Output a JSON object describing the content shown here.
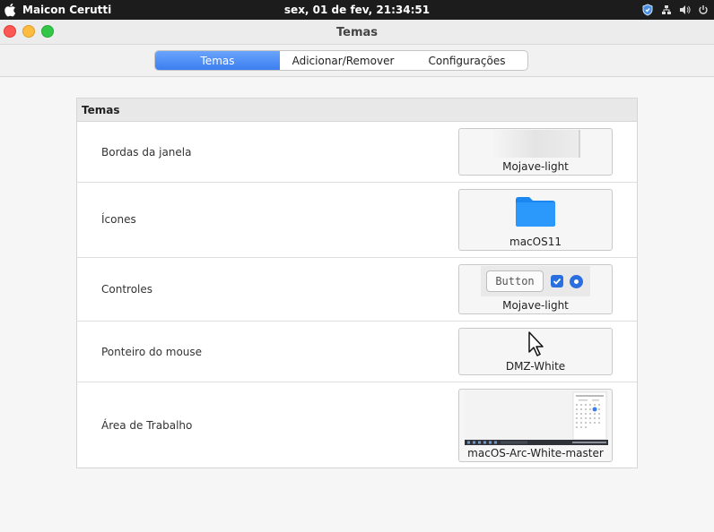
{
  "system_bar": {
    "user": "Maicon Cerutti",
    "clock": "sex, 01 de fev, 21:34:51",
    "icons": [
      "apple-icon",
      "shield-icon",
      "network-icon",
      "volume-icon",
      "power-icon"
    ]
  },
  "window": {
    "title": "Temas"
  },
  "tabs": [
    {
      "label": "Temas",
      "active": true
    },
    {
      "label": "Adicionar/Remover",
      "active": false
    },
    {
      "label": "Configurações",
      "active": false
    }
  ],
  "panel": {
    "header": "Temas",
    "rows": [
      {
        "label": "Bordas da janela",
        "value": "Mojave-light"
      },
      {
        "label": "Ícones",
        "value": "macOS11"
      },
      {
        "label": "Controles",
        "value": "Mojave-light",
        "preview_button": "Button"
      },
      {
        "label": "Ponteiro do mouse",
        "value": "DMZ-White"
      },
      {
        "label": "Área de Trabalho",
        "value": "macOS-Arc-White-master"
      }
    ]
  },
  "colors": {
    "accent": "#3b7ef0",
    "folder": "#1e8ff5"
  }
}
